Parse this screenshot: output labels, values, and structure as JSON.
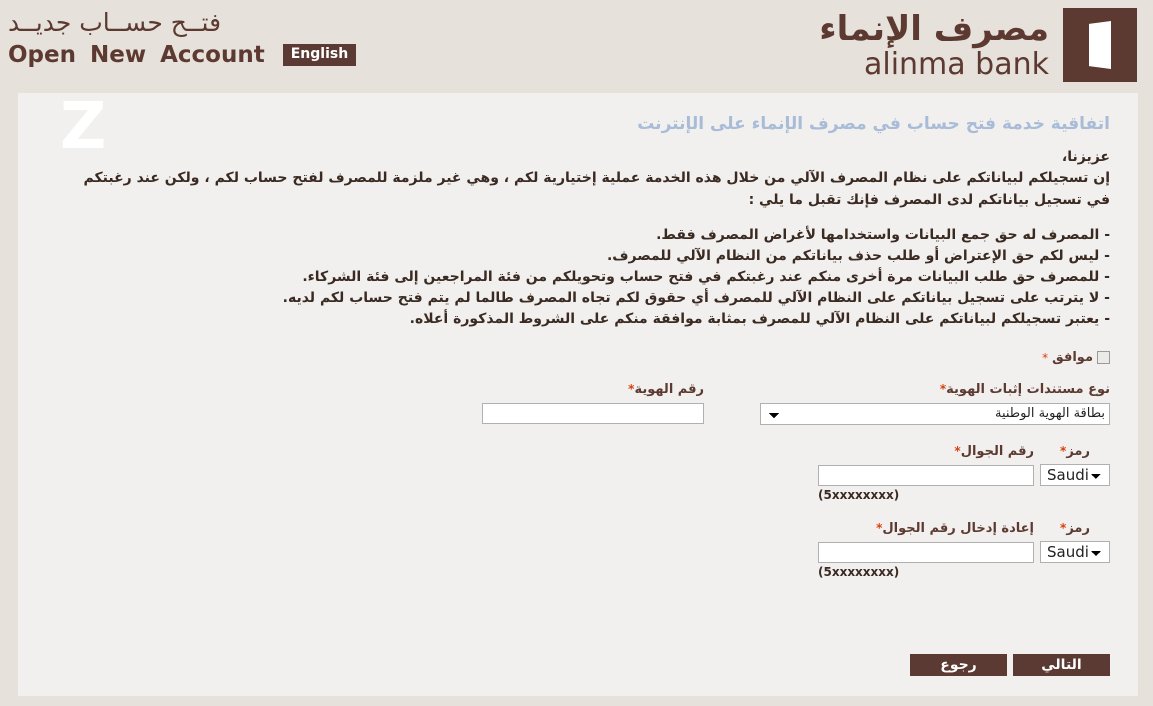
{
  "header": {
    "title_ar": "فتــح حســاب جديــد",
    "title_en": "Open New Account",
    "language_button": "English",
    "brand_ar": "مصرف الإنماء",
    "brand_en": "alinma bank",
    "brand_mark": "door-logo-icon"
  },
  "watermark": "Z",
  "page": {
    "title": "اتفاقية خدمة فتح حساب في مصرف الإنماء على الإنترنت",
    "salutation": "عزيزنا،",
    "intro_line1": "إن تسجيلكم لبياناتكم على نظام المصرف الآلي من خلال هذه الخدمة عملية إختيارية لكم ، وهي غير ملزمة للمصرف لفتح حساب لكم ، ولكن عند رغبتكم",
    "intro_line2": "في تسجيل بياناتكم لدى المصرف فإنك تقبل ما يلي :",
    "terms": [
      "- المصرف له حق جمع البيانات واستخدامها لأغراض المصرف فقط.",
      "- ليس لكم حق الإعتراض أو طلب حذف بياناتكم من النظام الآلي للمصرف.",
      "- للمصرف حق طلب البيانات مرة أخرى منكم عند رغبتكم في فتح حساب وتحويلكم من فئة المراجعين إلى فئة الشركاء.",
      "- لا يترتب على تسجيل بياناتكم على النظام الآلي للمصرف أي حقوق لكم تجاه المصرف طالما لم يتم فتح حساب لكم لديه.",
      "- يعتبر تسجيلكم لبياناتكم على النظام الآلي للمصرف بمثابة موافقة منكم على الشروط المذكورة أعلاه."
    ]
  },
  "form": {
    "agree_label": "موافق",
    "agree_checked": false,
    "required_mark": "*",
    "doc_type": {
      "label": "نوع مستندات إثبات الهوية",
      "value": "بطاقة الهوية الوطنية",
      "options": [
        "بطاقة الهوية الوطنية"
      ]
    },
    "id_number": {
      "label": "رقم الهوية",
      "value": "",
      "placeholder": ""
    },
    "mobile": {
      "label": "رقم الجوال",
      "code_label": "رمز",
      "code_value": "Saudi",
      "code_options": [
        "Saudi"
      ],
      "value": "",
      "hint": "(5xxxxxxxx)"
    },
    "mobile_confirm": {
      "label": "إعادة إدخال رقم الجوال",
      "code_label": "رمز",
      "code_value": "Saudi",
      "code_options": [
        "Saudi"
      ],
      "value": "",
      "hint": "(5xxxxxxxx)"
    }
  },
  "buttons": {
    "next": "التالي",
    "back": "رجوع"
  },
  "colors": {
    "brand_brown": "#5c3a31",
    "button_brown": "#5a3a32",
    "header_bg": "#e7e1db",
    "content_bg": "#f1f0ee",
    "title_blue": "#a8bcd8",
    "required_red": "#d93f10"
  }
}
